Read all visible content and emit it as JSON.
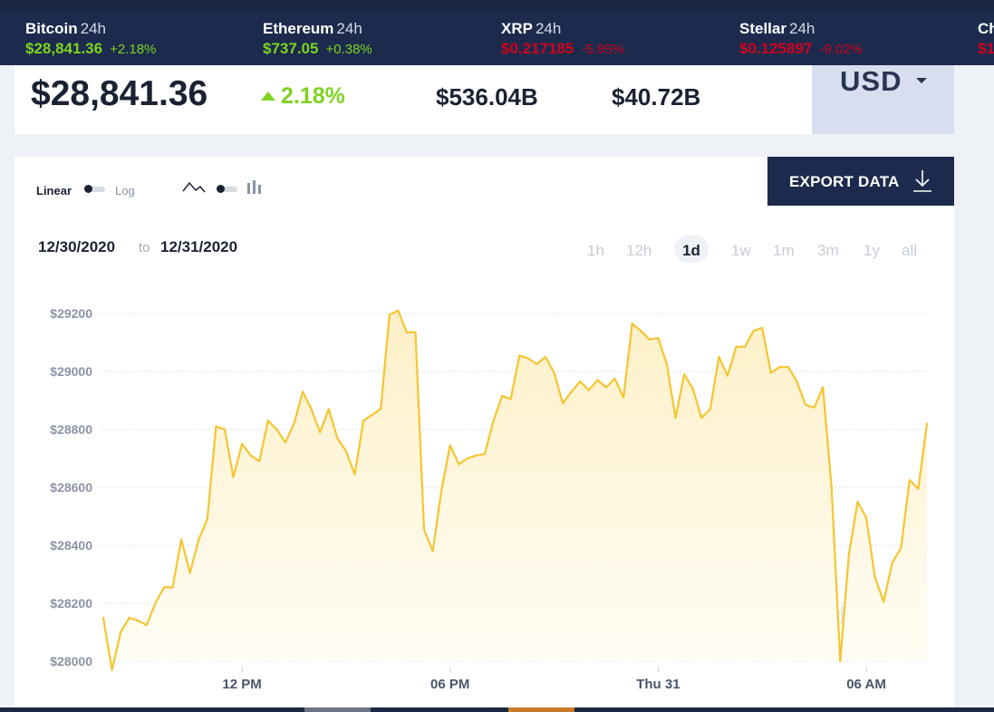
{
  "ticker": [
    {
      "name": "Bitcoin",
      "period": "24h",
      "price": "$28,841.36",
      "change": "+2.18%",
      "direction": "up"
    },
    {
      "name": "Ethereum",
      "period": "24h",
      "price": "$737.05",
      "change": "+0.38%",
      "direction": "up"
    },
    {
      "name": "XRP",
      "period": "24h",
      "price": "$0.217185",
      "change": "-5.95%",
      "direction": "down"
    },
    {
      "name": "Stellar",
      "period": "24h",
      "price": "$0.125897",
      "change": "-9.02%",
      "direction": "down"
    },
    {
      "name": "Ch",
      "period": "",
      "price": "$1",
      "change": "",
      "direction": "down"
    }
  ],
  "stats": {
    "price_symbol": "$",
    "price": "28,841.36",
    "change": "2.18%",
    "market_cap": "$536.04B",
    "volume": "$40.72B",
    "currency": "USD"
  },
  "controls": {
    "linear_label": "Linear",
    "log_label": "Log",
    "export_label": "EXPORT DATA",
    "date_from": "12/30/2020",
    "date_to_word": "to",
    "date_to": "12/31/2020",
    "ranges": [
      "1h",
      "12h",
      "1d",
      "1w",
      "1m",
      "3m",
      "1y",
      "all"
    ],
    "active_range": "1d",
    "watermark": "coindesk"
  },
  "colors": {
    "line": "#f5c530",
    "fill_top": "#fdf0c7",
    "fill_bottom": "#fffdf6",
    "positive": "#7ed321",
    "negative": "#d0021b",
    "navy": "#1c2b4d"
  },
  "chart_data": {
    "type": "area",
    "title": "",
    "xlabel": "",
    "ylabel": "",
    "ylim": [
      28000,
      29200
    ],
    "yticks": [
      28000,
      28200,
      28400,
      28600,
      28800,
      29000,
      29200
    ],
    "ytick_labels": [
      "$28000",
      "$28200",
      "$28400",
      "$28600",
      "$28800",
      "$29000",
      "$29200"
    ],
    "xticks": [
      {
        "hour": 12,
        "label": "12 PM"
      },
      {
        "hour": 18,
        "label": "06 PM"
      },
      {
        "hour": 24,
        "label": "Thu 31"
      },
      {
        "hour": 30,
        "label": "06 AM"
      }
    ],
    "x_unit": "hours from 12/30/2020 00:00",
    "grid": true,
    "series": [
      {
        "values": [
          [
            8.0,
            28150
          ],
          [
            8.25,
            27970
          ],
          [
            8.5,
            28100
          ],
          [
            8.75,
            28150
          ],
          [
            9.0,
            28140
          ],
          [
            9.25,
            28125
          ],
          [
            9.5,
            28200
          ],
          [
            9.75,
            28255
          ],
          [
            10.0,
            28255
          ],
          [
            10.25,
            28420
          ],
          [
            10.5,
            28305
          ],
          [
            10.75,
            28420
          ],
          [
            11.0,
            28490
          ],
          [
            11.25,
            28810
          ],
          [
            11.5,
            28800
          ],
          [
            11.75,
            28635
          ],
          [
            12.0,
            28750
          ],
          [
            12.25,
            28710
          ],
          [
            12.5,
            28690
          ],
          [
            12.75,
            28830
          ],
          [
            13.0,
            28800
          ],
          [
            13.25,
            28755
          ],
          [
            13.5,
            28820
          ],
          [
            13.75,
            28930
          ],
          [
            14.0,
            28870
          ],
          [
            14.25,
            28790
          ],
          [
            14.5,
            28870
          ],
          [
            14.75,
            28770
          ],
          [
            15.0,
            28725
          ],
          [
            15.25,
            28645
          ],
          [
            15.5,
            28830
          ],
          [
            15.75,
            28850
          ],
          [
            16.0,
            28870
          ],
          [
            16.25,
            29195
          ],
          [
            16.5,
            29210
          ],
          [
            16.75,
            29135
          ],
          [
            17.0,
            29135
          ],
          [
            17.25,
            28455
          ],
          [
            17.5,
            28380
          ],
          [
            17.75,
            28590
          ],
          [
            18.0,
            28745
          ],
          [
            18.25,
            28680
          ],
          [
            18.5,
            28700
          ],
          [
            18.75,
            28710
          ],
          [
            19.0,
            28715
          ],
          [
            19.25,
            28830
          ],
          [
            19.5,
            28915
          ],
          [
            19.75,
            28905
          ],
          [
            20.0,
            29055
          ],
          [
            20.25,
            29045
          ],
          [
            20.5,
            29025
          ],
          [
            20.75,
            29050
          ],
          [
            21.0,
            28995
          ],
          [
            21.25,
            28890
          ],
          [
            21.5,
            28930
          ],
          [
            21.75,
            28965
          ],
          [
            22.0,
            28935
          ],
          [
            22.25,
            28970
          ],
          [
            22.5,
            28945
          ],
          [
            22.75,
            28975
          ],
          [
            23.0,
            28910
          ],
          [
            23.25,
            29165
          ],
          [
            23.5,
            29140
          ],
          [
            23.75,
            29110
          ],
          [
            24.0,
            29115
          ],
          [
            24.25,
            29025
          ],
          [
            24.5,
            28840
          ],
          [
            24.75,
            28990
          ],
          [
            25.0,
            28940
          ],
          [
            25.25,
            28840
          ],
          [
            25.5,
            28870
          ],
          [
            25.75,
            29050
          ],
          [
            26.0,
            28985
          ],
          [
            26.25,
            29085
          ],
          [
            26.5,
            29085
          ],
          [
            26.75,
            29140
          ],
          [
            27.0,
            29150
          ],
          [
            27.25,
            28995
          ],
          [
            27.5,
            29015
          ],
          [
            27.75,
            29015
          ],
          [
            28.0,
            28965
          ],
          [
            28.25,
            28885
          ],
          [
            28.5,
            28875
          ],
          [
            28.75,
            28945
          ],
          [
            29.0,
            28600
          ],
          [
            29.25,
            28000
          ],
          [
            29.5,
            28370
          ],
          [
            29.75,
            28550
          ],
          [
            30.0,
            28495
          ],
          [
            30.25,
            28290
          ],
          [
            30.5,
            28205
          ],
          [
            30.75,
            28340
          ],
          [
            31.0,
            28390
          ],
          [
            31.25,
            28625
          ],
          [
            31.5,
            28595
          ],
          [
            31.75,
            28820
          ]
        ]
      }
    ]
  }
}
